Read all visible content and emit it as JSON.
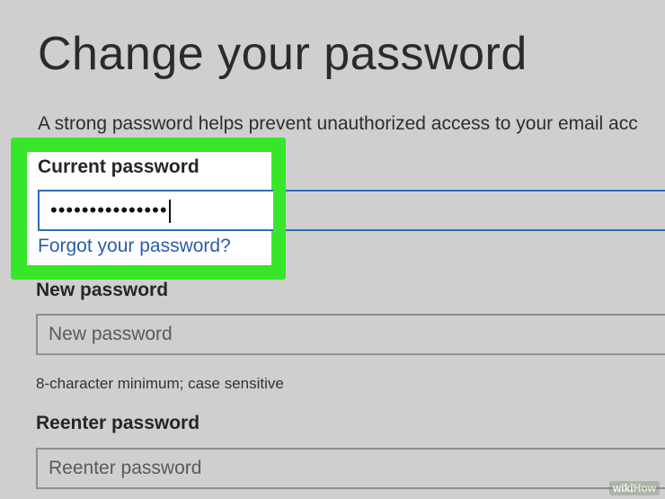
{
  "page": {
    "title": "Change your password",
    "description": "A strong password helps prevent unauthorized access to your email acc"
  },
  "current_password": {
    "label": "Current password",
    "value": "•••••••••••••••",
    "forgot_link": "Forgot your password?"
  },
  "new_password": {
    "label": "New password",
    "placeholder": "New password",
    "hint": "8-character minimum; case sensitive"
  },
  "reenter_password": {
    "label": "Reenter password",
    "placeholder": "Reenter password"
  },
  "watermark": {
    "part1": "wiki",
    "part2": "How"
  },
  "colors": {
    "highlight": "#37e62a",
    "focus_border": "#2c6db8",
    "link": "#2a5da8",
    "background": "#cfcfcf"
  }
}
